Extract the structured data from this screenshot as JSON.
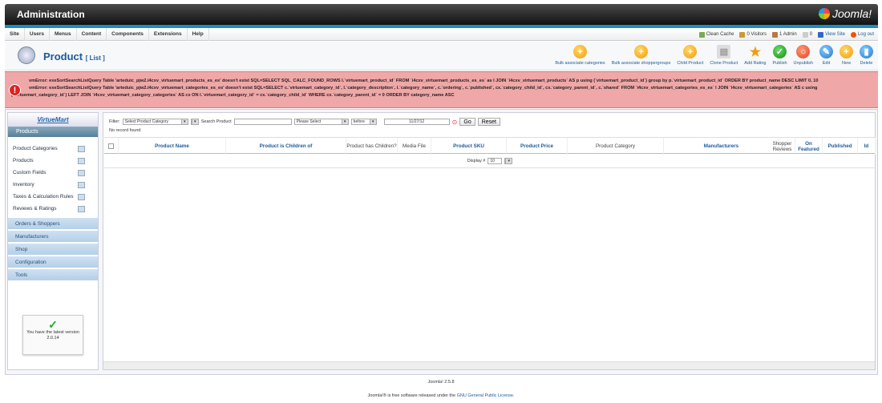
{
  "header": {
    "title": "Administration",
    "logo": "Joomla!"
  },
  "menu": [
    "Site",
    "Users",
    "Menus",
    "Content",
    "Components",
    "Extensions",
    "Help"
  ],
  "status": [
    {
      "label": "Clean Cache",
      "icon": "broom-icon"
    },
    {
      "label": "0 Visitors",
      "icon": "users-icon"
    },
    {
      "label": "1 Admin",
      "icon": "admin-icon"
    },
    {
      "label": "0",
      "icon": "mail-icon"
    },
    {
      "label": "View Site",
      "icon": "monitor-icon"
    },
    {
      "label": "Log out",
      "icon": "logout-icon"
    }
  ],
  "page": {
    "title": "Product",
    "subtitle": "[ List ]"
  },
  "toolbar": [
    {
      "label": "Bulk associate categories",
      "icon": "plus-icon",
      "color": "orange",
      "glyph": "+"
    },
    {
      "label": "Bulk associate shoppergroups",
      "icon": "plus-icon",
      "color": "orange",
      "glyph": "+"
    },
    {
      "label": "Child Product",
      "icon": "plus-icon",
      "color": "orange",
      "glyph": "+"
    },
    {
      "label": "Clone Product",
      "icon": "copy-icon",
      "color": "gray",
      "glyph": "▤"
    },
    {
      "label": "Add Rating",
      "icon": "star-icon",
      "color": "star",
      "glyph": "★"
    },
    {
      "label": "Publish",
      "icon": "check-icon",
      "color": "green",
      "glyph": "✓"
    },
    {
      "label": "Unpublish",
      "icon": "circle-icon",
      "color": "red",
      "glyph": "○"
    },
    {
      "label": "Edit",
      "icon": "pencil-icon",
      "color": "blue",
      "glyph": "✎"
    },
    {
      "label": "New",
      "icon": "plus-icon",
      "color": "orange",
      "glyph": "+"
    },
    {
      "label": "Delete",
      "icon": "trash-icon",
      "color": "blue",
      "glyph": "▮"
    }
  ],
  "errors": [
    "vmError: exeSortSearchListQuery Table 'arteduic_pjw2.i4cxv_virtuemart_products_es_es' doesn't exist SQL=SELECT SQL_CALC_FOUND_ROWS l.`virtuemart_product_id` FROM `i4cxv_virtuemart_products_es_es` as l JOIN `i4cxv_virtuemart_products` AS p using (`virtuemart_product_id`) group by p.`virtuemart_product_id` ORDER BY product_name DESC LIMIT 0, 10",
    "vmError: exeSortSearchListQuery Table 'arteduic_pjw2.i4cxv_virtuemart_categories_es_es' doesn't exist SQL=SELECT c.`virtuemart_category_id`, l.`category_description`, l.`category_name`, c.`ordering`, c.`published`, cx.`category_child_id`, cx.`category_parent_id`, c.`shared` FROM `i4cxv_virtuemart_categories_es_es` l JOIN `i4cxv_virtuemart_categories` AS c using (`virtuemart_category_id`) LEFT JOIN `i4cxv_virtuemart_category_categories` AS cx ON l.`virtuemart_category_id` = cx.`category_child_id` WHERE cx.`category_parent_id` = 0 ORDER BY category_name ASC"
  ],
  "sidebar": {
    "logo": "VirtueMart",
    "heading": "Products",
    "items": [
      "Product Categories",
      "Products",
      "Custom Fields",
      "Inventory",
      "Taxes & Calculation Rules",
      "Reviews & Ratings"
    ],
    "sections": [
      "Orders & Shoppers",
      "Manufacturers",
      "Shop",
      "Configuration",
      "Tools"
    ],
    "version_text": "You have the latest version",
    "version": "2.0.14"
  },
  "filter": {
    "label": "Filter:",
    "category": "Select Product Category",
    "search_label": "Search Product",
    "search_value": "",
    "select": "Please Select",
    "when": "before",
    "date": "11/27/12",
    "go": "Go",
    "reset": "Reset"
  },
  "no_record": "No record found",
  "columns": [
    {
      "label": "Product Name",
      "link": true
    },
    {
      "label": "Product is Children of",
      "link": true
    },
    {
      "label": "Product has Children?",
      "link": false
    },
    {
      "label": "Media File",
      "link": false
    },
    {
      "label": "Product SKU",
      "link": true
    },
    {
      "label": "Product Price",
      "link": true
    },
    {
      "label": "Product Category",
      "link": false
    },
    {
      "label": "Manufacturers",
      "link": true
    },
    {
      "label": "Shopper Reviews",
      "link": false
    },
    {
      "label": "On Featured",
      "link": true
    },
    {
      "label": "Published",
      "link": true
    },
    {
      "label": "Id",
      "link": true
    }
  ],
  "display": {
    "label": "Display #",
    "value": "10"
  },
  "footer": {
    "version": "Joomla! 2.5.8",
    "license_prefix": "Joomla!® is free software released under the",
    "license_link": "GNU General Public License",
    "license_suffix": "."
  }
}
